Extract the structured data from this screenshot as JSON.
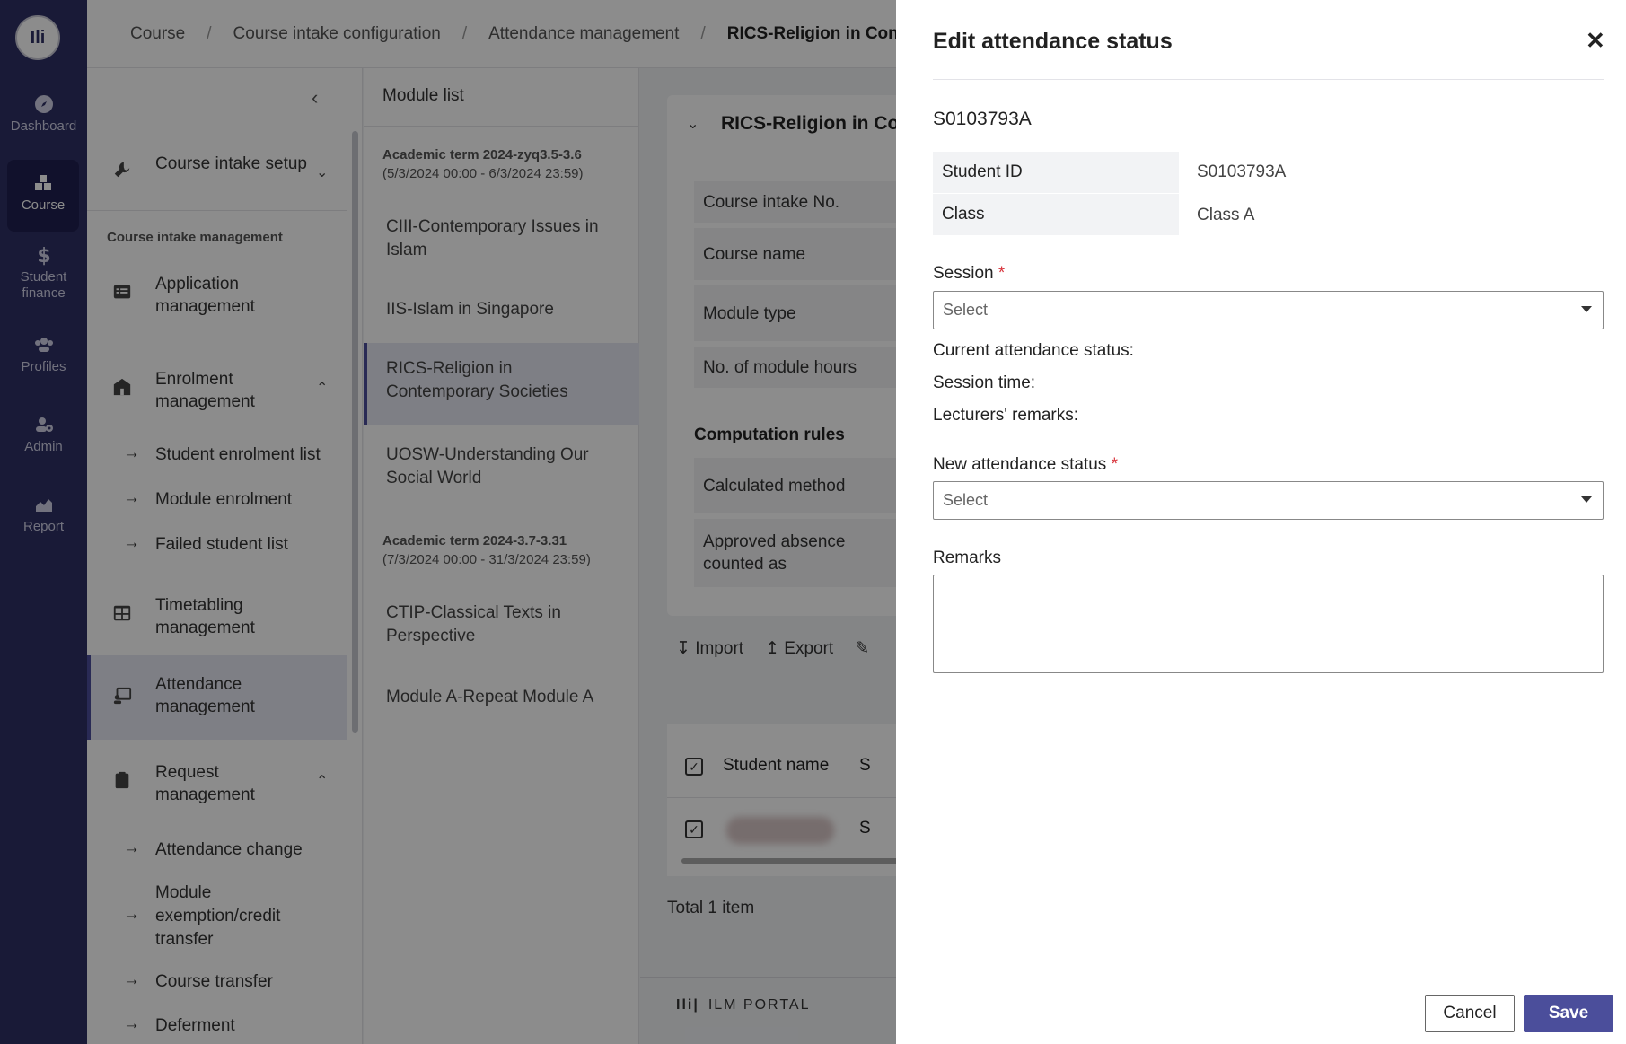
{
  "rail": {
    "items": [
      {
        "label": "Dashboard",
        "icon": "compass-icon"
      },
      {
        "label": "Course",
        "icon": "cubes-icon"
      },
      {
        "label": "Student finance",
        "icon": "dollar-icon"
      },
      {
        "label": "Profiles",
        "icon": "users-icon"
      },
      {
        "label": "Admin",
        "icon": "user-gear-icon"
      },
      {
        "label": "Report",
        "icon": "area-chart-icon"
      }
    ]
  },
  "breadcrumb": {
    "items": [
      "Course",
      "Course intake configuration",
      "Attendance management",
      "RICS-Religion in Contemporary Societies"
    ]
  },
  "sidenav": {
    "course_intake_setup": "Course intake setup",
    "section_title": "Course intake management",
    "application_management": "Application management",
    "enrolment_management": "Enrolment management",
    "student_enrolment_list": "Student enrolment list",
    "module_enrolment": "Module enrolment",
    "failed_student_list": "Failed student list",
    "timetabling_management": "Timetabling management",
    "attendance_management": "Attendance management",
    "request_management": "Request management",
    "attendance_change": "Attendance change",
    "module_exemption": "Module exemption/credit transfer",
    "course_transfer": "Course transfer",
    "deferment": "Deferment"
  },
  "modlist": {
    "title": "Module list",
    "term1_title": "Academic term 2024-zyq3.5-3.6",
    "term1_dates": "(5/3/2024 00:00 - 6/3/2024 23:59)",
    "term1_modules": [
      "CIII-Contemporary Issues in Islam",
      "IIS-Islam in Singapore",
      "RICS-Religion in Contemporary Societies",
      "UOSW-Understanding Our Social World"
    ],
    "term2_title": "Academic term 2024-3.7-3.31",
    "term2_dates": "(7/3/2024 00:00 - 31/3/2024 23:59)",
    "term2_modules": [
      "CTIP-Classical Texts in Perspective",
      "Module A-Repeat Module A"
    ]
  },
  "content": {
    "card_title": "RICS-Religion in Contemporary Societies",
    "rows": [
      "Course intake No.",
      "Course name",
      "Module type",
      "No. of module hours"
    ],
    "computation_title": "Computation rules",
    "comp_rows": [
      "Calculated method",
      "Approved absence counted as"
    ],
    "toolbar": {
      "import": "Import",
      "export": "Export"
    },
    "table_header_name": "Student name",
    "table_header_next": "S",
    "row_cell_next": "S",
    "total": "Total 1 item",
    "footer_brand": "ILM PORTAL"
  },
  "drawer": {
    "title": "Edit attendance status",
    "student_heading": "S0103793A",
    "student_id_label": "Student ID",
    "student_id_value": "S0103793A",
    "class_label": "Class",
    "class_value": "Class A",
    "session_label": "Session",
    "session_placeholder": "Select",
    "current_status_label": "Current attendance status:",
    "session_time_label": "Session time:",
    "lecturer_remarks_label": "Lecturers' remarks:",
    "new_status_label": "New attendance status",
    "new_status_placeholder": "Select",
    "remarks_label": "Remarks",
    "remarks_value": "",
    "cancel_label": "Cancel",
    "save_label": "Save",
    "required_mark": "*"
  },
  "colors": {
    "rail_bg": "#2f3064",
    "accent": "#4b4e9b",
    "required": "#d9363e"
  }
}
